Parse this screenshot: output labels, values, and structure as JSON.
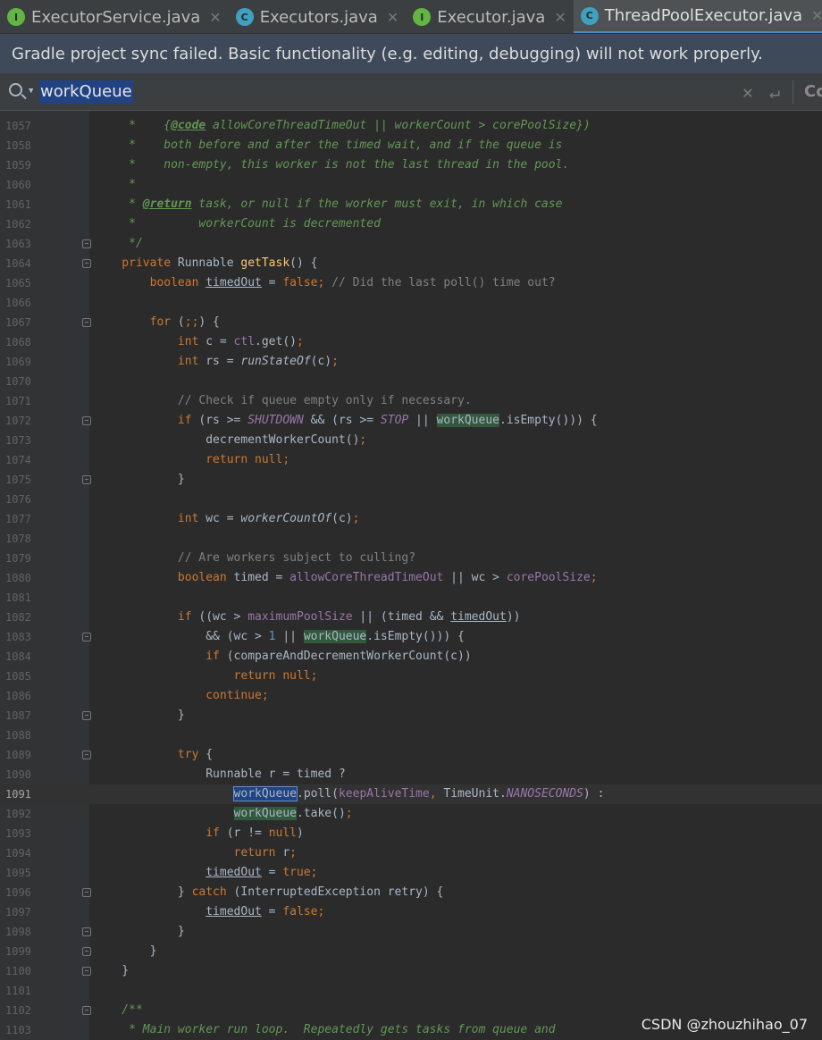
{
  "tabs": [
    {
      "label": "ExecutorService.java",
      "icon": "I",
      "kind": "iface",
      "active": false
    },
    {
      "label": "Executors.java",
      "icon": "C",
      "kind": "cls",
      "active": false
    },
    {
      "label": "Executor.java",
      "icon": "I",
      "kind": "iface",
      "active": false
    },
    {
      "label": "ThreadPoolExecutor.java",
      "icon": "C",
      "kind": "cls",
      "active": true
    }
  ],
  "banner": {
    "message": "Gradle project sync failed. Basic functionality (e.g. editing, debugging) will not work properly."
  },
  "search": {
    "value": "workQueue",
    "trailing": "Cc"
  },
  "watermark": "CSDN @zhouzhihao_07",
  "editor": {
    "current_line": 1091,
    "lines": [
      {
        "n": 1057,
        "fold": false,
        "t": [
          [
            "doc",
            "     *    {"
          ],
          [
            "tag",
            "@code"
          ],
          [
            "doc",
            " allowCoreThreadTimeOut || workerCount > corePoolSize})"
          ]
        ]
      },
      {
        "n": 1058,
        "fold": false,
        "t": [
          [
            "doc",
            "     *    both before and after the timed wait, and if the queue is"
          ]
        ]
      },
      {
        "n": 1059,
        "fold": false,
        "t": [
          [
            "doc",
            "     *    non-empty, this worker is not the last thread in the pool."
          ]
        ]
      },
      {
        "n": 1060,
        "fold": false,
        "t": [
          [
            "doc",
            "     *"
          ]
        ]
      },
      {
        "n": 1061,
        "fold": false,
        "t": [
          [
            "doc",
            "     * "
          ],
          [
            "tag",
            "@return"
          ],
          [
            "doc",
            " task, or null if the worker must exit, in which case"
          ]
        ]
      },
      {
        "n": 1062,
        "fold": false,
        "t": [
          [
            "doc",
            "     *         workerCount is decremented"
          ]
        ]
      },
      {
        "n": 1063,
        "fold": true,
        "t": [
          [
            "doc",
            "     */"
          ]
        ]
      },
      {
        "n": 1064,
        "fold": true,
        "t": [
          [
            "kw",
            "    private "
          ],
          [
            "p",
            "Runnable "
          ],
          [
            "fn",
            "getTask"
          ],
          [
            "p",
            "() {"
          ]
        ]
      },
      {
        "n": 1065,
        "fold": false,
        "t": [
          [
            "kw",
            "        boolean "
          ],
          [
            "ul",
            "timedOut"
          ],
          [
            "p",
            " = "
          ],
          [
            "kw",
            "false; "
          ],
          [
            "cmt",
            "// Did the last poll() time out?"
          ]
        ]
      },
      {
        "n": 1066,
        "fold": false,
        "t": []
      },
      {
        "n": 1067,
        "fold": true,
        "t": [
          [
            "kw",
            "        for "
          ],
          [
            "p",
            "("
          ],
          [
            "kw",
            ";;"
          ],
          [
            "p",
            ") {"
          ]
        ]
      },
      {
        "n": 1068,
        "fold": false,
        "t": [
          [
            "kw",
            "            int "
          ],
          [
            "p",
            "c = "
          ],
          [
            "fld",
            "ctl"
          ],
          [
            "p",
            ".get()"
          ],
          [
            "kw",
            ";"
          ]
        ]
      },
      {
        "n": 1069,
        "fold": false,
        "t": [
          [
            "kw",
            "            int "
          ],
          [
            "p",
            "rs = "
          ],
          [
            "static",
            "runStateOf"
          ],
          [
            "p",
            "(c)"
          ],
          [
            "kw",
            ";"
          ]
        ]
      },
      {
        "n": 1070,
        "fold": false,
        "t": []
      },
      {
        "n": 1071,
        "fold": false,
        "t": [
          [
            "cmt",
            "            // Check if queue empty only if necessary."
          ]
        ]
      },
      {
        "n": 1072,
        "fold": true,
        "t": [
          [
            "kw",
            "            if "
          ],
          [
            "p",
            "(rs >= "
          ],
          [
            "sfld",
            "SHUTDOWN"
          ],
          [
            "p",
            " && (rs >= "
          ],
          [
            "sfld",
            "STOP"
          ],
          [
            "p",
            " || "
          ],
          [
            "hlf",
            "workQueue"
          ],
          [
            "p",
            ".isEmpty())) {"
          ]
        ]
      },
      {
        "n": 1073,
        "fold": false,
        "t": [
          [
            "p",
            "                decrementWorkerCount()"
          ],
          [
            "kw",
            ";"
          ]
        ]
      },
      {
        "n": 1074,
        "fold": false,
        "t": [
          [
            "kw",
            "                return null;"
          ]
        ]
      },
      {
        "n": 1075,
        "fold": true,
        "t": [
          [
            "p",
            "            }"
          ]
        ]
      },
      {
        "n": 1076,
        "fold": false,
        "t": []
      },
      {
        "n": 1077,
        "fold": false,
        "t": [
          [
            "kw",
            "            int "
          ],
          [
            "p",
            "wc = "
          ],
          [
            "static",
            "workerCountOf"
          ],
          [
            "p",
            "(c)"
          ],
          [
            "kw",
            ";"
          ]
        ]
      },
      {
        "n": 1078,
        "fold": false,
        "t": []
      },
      {
        "n": 1079,
        "fold": false,
        "t": [
          [
            "cmt",
            "            // Are workers subject to culling?"
          ]
        ]
      },
      {
        "n": 1080,
        "fold": false,
        "t": [
          [
            "kw",
            "            boolean "
          ],
          [
            "p",
            "timed = "
          ],
          [
            "fld",
            "allowCoreThreadTimeOut"
          ],
          [
            "p",
            " || wc > "
          ],
          [
            "fld",
            "corePoolSize"
          ],
          [
            "kw",
            ";"
          ]
        ]
      },
      {
        "n": 1081,
        "fold": false,
        "t": []
      },
      {
        "n": 1082,
        "fold": false,
        "t": [
          [
            "kw",
            "            if "
          ],
          [
            "p",
            "((wc > "
          ],
          [
            "fld",
            "maximumPoolSize"
          ],
          [
            "p",
            " || (timed && "
          ],
          [
            "ul",
            "timedOut"
          ],
          [
            "p",
            "))"
          ]
        ]
      },
      {
        "n": 1083,
        "fold": true,
        "t": [
          [
            "p",
            "                && (wc > "
          ],
          [
            "num",
            "1"
          ],
          [
            "p",
            " || "
          ],
          [
            "hlf",
            "workQueue"
          ],
          [
            "p",
            ".isEmpty())) {"
          ]
        ]
      },
      {
        "n": 1084,
        "fold": false,
        "t": [
          [
            "kw",
            "                if "
          ],
          [
            "p",
            "(compareAndDecrementWorkerCount(c))"
          ]
        ]
      },
      {
        "n": 1085,
        "fold": false,
        "t": [
          [
            "kw",
            "                    return null;"
          ]
        ]
      },
      {
        "n": 1086,
        "fold": false,
        "t": [
          [
            "kw",
            "                continue;"
          ]
        ]
      },
      {
        "n": 1087,
        "fold": true,
        "t": [
          [
            "p",
            "            }"
          ]
        ]
      },
      {
        "n": 1088,
        "fold": false,
        "t": []
      },
      {
        "n": 1089,
        "fold": true,
        "t": [
          [
            "kw",
            "            try "
          ],
          [
            "p",
            "{"
          ]
        ]
      },
      {
        "n": 1090,
        "fold": false,
        "t": [
          [
            "p",
            "                Runnable r = timed ?"
          ]
        ]
      },
      {
        "n": 1091,
        "fold": false,
        "t": [
          [
            "p",
            "                    "
          ],
          [
            "hlcur",
            "workQueue"
          ],
          [
            "p",
            ".poll("
          ],
          [
            "fld",
            "keepAliveTime"
          ],
          [
            "kw",
            ", "
          ],
          [
            "p",
            "TimeUnit."
          ],
          [
            "sfld",
            "NANOSECONDS"
          ],
          [
            "p",
            ") :"
          ]
        ]
      },
      {
        "n": 1092,
        "fold": false,
        "t": [
          [
            "p",
            "                    "
          ],
          [
            "hlf",
            "workQueue"
          ],
          [
            "p",
            ".take()"
          ],
          [
            "kw",
            ";"
          ]
        ]
      },
      {
        "n": 1093,
        "fold": false,
        "t": [
          [
            "kw",
            "                if "
          ],
          [
            "p",
            "(r != "
          ],
          [
            "kw",
            "null"
          ],
          [
            "p",
            ")"
          ]
        ]
      },
      {
        "n": 1094,
        "fold": false,
        "t": [
          [
            "kw",
            "                    return "
          ],
          [
            "p",
            "r"
          ],
          [
            "kw",
            ";"
          ]
        ]
      },
      {
        "n": 1095,
        "fold": false,
        "t": [
          [
            "p",
            "                "
          ],
          [
            "ul",
            "timedOut"
          ],
          [
            "p",
            " = "
          ],
          [
            "kw",
            "true;"
          ]
        ]
      },
      {
        "n": 1096,
        "fold": true,
        "t": [
          [
            "p",
            "            } "
          ],
          [
            "kw",
            "catch "
          ],
          [
            "p",
            "(InterruptedException retry) {"
          ]
        ]
      },
      {
        "n": 1097,
        "fold": false,
        "t": [
          [
            "p",
            "                "
          ],
          [
            "ul",
            "timedOut"
          ],
          [
            "p",
            " = "
          ],
          [
            "kw",
            "false;"
          ]
        ]
      },
      {
        "n": 1098,
        "fold": true,
        "t": [
          [
            "p",
            "            }"
          ]
        ]
      },
      {
        "n": 1099,
        "fold": true,
        "t": [
          [
            "p",
            "        }"
          ]
        ]
      },
      {
        "n": 1100,
        "fold": true,
        "t": [
          [
            "p",
            "    }"
          ]
        ]
      },
      {
        "n": 1101,
        "fold": false,
        "t": []
      },
      {
        "n": 1102,
        "fold": true,
        "t": [
          [
            "doc",
            "    /**"
          ]
        ]
      },
      {
        "n": 1103,
        "fold": false,
        "t": [
          [
            "doc",
            "     * Main worker run loop.  Repeatedly gets tasks from queue and"
          ]
        ]
      }
    ]
  }
}
